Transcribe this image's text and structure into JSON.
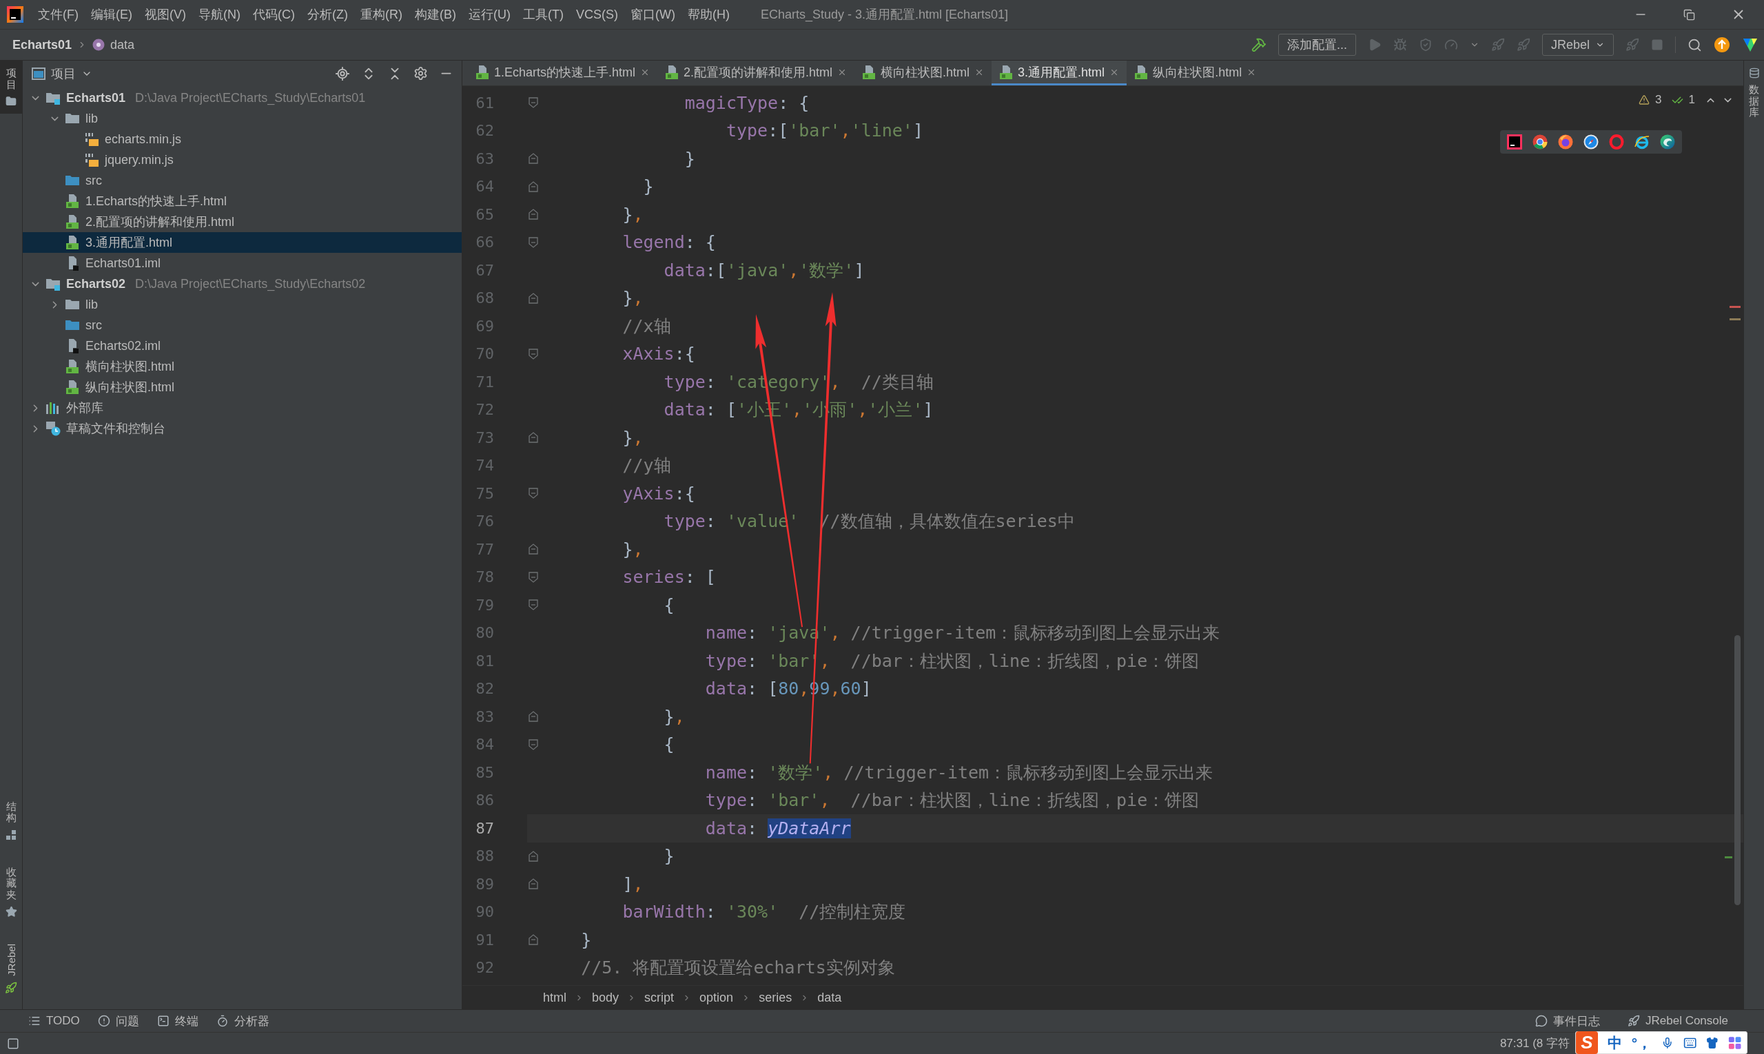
{
  "window": {
    "title": "ECharts_Study - 3.通用配置.html [Echarts01]"
  },
  "menu": [
    "文件(F)",
    "编辑(E)",
    "视图(V)",
    "导航(N)",
    "代码(C)",
    "分析(Z)",
    "重构(R)",
    "构建(B)",
    "运行(U)",
    "工具(T)",
    "VCS(S)",
    "窗口(W)",
    "帮助(H)"
  ],
  "navbar": {
    "breadcrumb": [
      {
        "label": "Echarts01",
        "kind": "module"
      },
      {
        "label": "data",
        "kind": "property"
      }
    ],
    "run_config": "添加配置...",
    "jrebel_menu": "JRebel"
  },
  "left_strip": {
    "top": [
      {
        "label": "项目",
        "kind": "project",
        "selected": true
      }
    ],
    "bottom": [
      {
        "label": "结构",
        "kind": "structure",
        "selected": false
      },
      {
        "label": "收藏夹",
        "kind": "favorites",
        "selected": false
      },
      {
        "label": "JRebel",
        "kind": "jrebel",
        "selected": false
      }
    ]
  },
  "project": {
    "title": "项目",
    "tree": [
      {
        "label": "Echarts01",
        "path": "D:\\Java Project\\ECharts_Study\\Echarts01",
        "kind": "module",
        "expanded": true,
        "selected": false,
        "children": [
          {
            "label": "lib",
            "kind": "folder",
            "expanded": true,
            "selected": false,
            "children": [
              {
                "label": "echarts.min.js",
                "kind": "js",
                "selected": false
              },
              {
                "label": "jquery.min.js",
                "kind": "js",
                "selected": false
              }
            ]
          },
          {
            "label": "src",
            "kind": "source",
            "selected": false
          },
          {
            "label": "1.Echarts的快速上手.html",
            "kind": "html",
            "selected": false
          },
          {
            "label": "2.配置项的讲解和使用.html",
            "kind": "html",
            "selected": false
          },
          {
            "label": "3.通用配置.html",
            "kind": "html",
            "selected": true
          },
          {
            "label": "Echarts01.iml",
            "kind": "iml",
            "selected": false
          }
        ]
      },
      {
        "label": "Echarts02",
        "path": "D:\\Java Project\\ECharts_Study\\Echarts02",
        "kind": "module",
        "expanded": true,
        "selected": false,
        "children": [
          {
            "label": "lib",
            "kind": "folder",
            "expanded": false,
            "selected": false
          },
          {
            "label": "src",
            "kind": "source",
            "selected": false
          },
          {
            "label": "Echarts02.iml",
            "kind": "iml",
            "selected": false
          },
          {
            "label": "横向柱状图.html",
            "kind": "html",
            "selected": false
          },
          {
            "label": "纵向柱状图.html",
            "kind": "html",
            "selected": false
          }
        ]
      },
      {
        "label": "外部库",
        "kind": "library",
        "expanded": false,
        "selected": false
      },
      {
        "label": "草稿文件和控制台",
        "kind": "scratch",
        "expanded": false,
        "selected": false
      }
    ]
  },
  "tabs": [
    {
      "label": "1.Echarts的快速上手.html",
      "selected": false
    },
    {
      "label": "2.配置项的讲解和使用.html",
      "selected": false
    },
    {
      "label": "横向柱状图.html",
      "selected": false
    },
    {
      "label": "3.通用配置.html",
      "selected": true
    },
    {
      "label": "纵向柱状图.html",
      "selected": false
    }
  ],
  "editor": {
    "inspections": {
      "warnings": "3",
      "passed": "1"
    },
    "lines": [
      {
        "number": "61",
        "text": "              magicType: {",
        "kind": "fold_start",
        "current": false
      },
      {
        "number": "62",
        "text": "                  type:['bar','line']",
        "kind": "plain",
        "current": false
      },
      {
        "number": "63",
        "text": "              }",
        "kind": "fold_end",
        "current": false
      },
      {
        "number": "64",
        "text": "          }",
        "kind": "fold_end",
        "current": false
      },
      {
        "number": "65",
        "text": "        },",
        "kind": "fold_end",
        "current": false
      },
      {
        "number": "66",
        "text": "        legend: {",
        "kind": "fold_start",
        "current": false
      },
      {
        "number": "67",
        "text": "            data:['java','数学']",
        "kind": "plain",
        "current": false
      },
      {
        "number": "68",
        "text": "        },",
        "kind": "fold_end",
        "current": false
      },
      {
        "number": "69",
        "text": "        //x轴",
        "kind": "plain",
        "current": false
      },
      {
        "number": "70",
        "text": "        xAxis:{",
        "kind": "fold_start",
        "current": false
      },
      {
        "number": "71",
        "text": "            type: 'category',  //类目轴",
        "kind": "plain",
        "current": false
      },
      {
        "number": "72",
        "text": "            data: ['小王','小雨','小兰']",
        "kind": "plain",
        "current": false
      },
      {
        "number": "73",
        "text": "        },",
        "kind": "fold_end",
        "current": false
      },
      {
        "number": "74",
        "text": "        //y轴",
        "kind": "plain",
        "current": false
      },
      {
        "number": "75",
        "text": "        yAxis:{",
        "kind": "fold_start",
        "current": false
      },
      {
        "number": "76",
        "text": "            type: 'value'  //数值轴，具体数值在series中",
        "kind": "plain",
        "current": false
      },
      {
        "number": "77",
        "text": "        },",
        "kind": "fold_end",
        "current": false
      },
      {
        "number": "78",
        "text": "        series: [",
        "kind": "fold_start",
        "current": false
      },
      {
        "number": "79",
        "text": "            {",
        "kind": "fold_start",
        "current": false
      },
      {
        "number": "80",
        "text": "                name: 'java', //trigger-item：鼠标移动到图上会显示出来",
        "kind": "plain",
        "current": false
      },
      {
        "number": "81",
        "text": "                type: 'bar',  //bar：柱状图，line：折线图，pie：饼图",
        "kind": "plain",
        "current": false
      },
      {
        "number": "82",
        "text": "                data: [80,99,60]",
        "kind": "plain",
        "current": false
      },
      {
        "number": "83",
        "text": "            },",
        "kind": "fold_end",
        "current": false
      },
      {
        "number": "84",
        "text": "            {",
        "kind": "fold_start",
        "current": false
      },
      {
        "number": "85",
        "text": "                name: '数学', //trigger-item：鼠标移动到图上会显示出来",
        "kind": "plain",
        "current": false
      },
      {
        "number": "86",
        "text": "                type: 'bar',  //bar：柱状图，line：折线图，pie：饼图",
        "kind": "plain",
        "current": false
      },
      {
        "number": "87",
        "text": "                data: ",
        "selected_text": "yDataArr",
        "kind": "plain",
        "current": true
      },
      {
        "number": "88",
        "text": "            }",
        "kind": "fold_end",
        "current": false
      },
      {
        "number": "89",
        "text": "        ],",
        "kind": "fold_end",
        "current": false
      },
      {
        "number": "90",
        "text": "        barWidth: '30%'  //控制柱宽度",
        "kind": "plain",
        "current": false
      },
      {
        "number": "91",
        "text": "    }",
        "kind": "fold_end",
        "current": false
      },
      {
        "number": "92",
        "text": "    //5. 将配置项设置给echarts实例对象",
        "kind": "plain",
        "current": false
      }
    ],
    "annotations": [
      {
        "kind": "arrow"
      },
      {
        "kind": "arrow"
      }
    ],
    "breadcrumb": [
      "html",
      "body",
      "script",
      "option",
      "series",
      "data"
    ]
  },
  "right_strip": [
    {
      "label": "数据库",
      "kind": "database",
      "selected": false
    }
  ],
  "bottom_tools": [
    {
      "label": "TODO",
      "kind": "todo"
    },
    {
      "label": "问题",
      "kind": "problems"
    },
    {
      "label": "终端",
      "kind": "terminal"
    },
    {
      "label": "分析器",
      "kind": "profiler"
    }
  ],
  "bottom_right": [
    {
      "label": "事件日志",
      "kind": "events"
    },
    {
      "label": "JRebel Console",
      "kind": "jrebel"
    }
  ],
  "status": {
    "caret": "87:31 (8 字符"
  },
  "ime": {
    "logo": "S",
    "mode": "中",
    "punctuation": "°，"
  }
}
